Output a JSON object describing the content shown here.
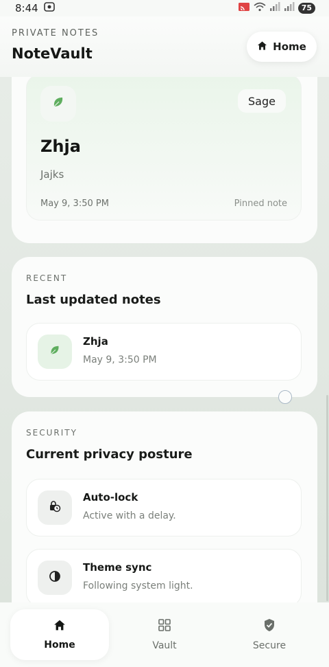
{
  "status_bar": {
    "time": "8:44",
    "battery": "75"
  },
  "header": {
    "eyebrow": "PRIVATE NOTES",
    "title": "NoteVault",
    "home_label": "Home"
  },
  "pinned": {
    "tag": "Sage",
    "title": "Zhja",
    "body": "Jajks",
    "date": "May 9, 3:50 PM",
    "flag": "Pinned note",
    "icon": "leaf-icon"
  },
  "recent": {
    "eyebrow": "RECENT",
    "heading": "Last updated notes",
    "items": [
      {
        "title": "Zhja",
        "date": "May 9, 3:50 PM",
        "icon": "leaf-icon"
      }
    ]
  },
  "security": {
    "eyebrow": "SECURITY",
    "heading": "Current privacy posture",
    "items": [
      {
        "title": "Auto-lock",
        "subtitle": "Active with a delay.",
        "icon": "lock-timer-icon"
      },
      {
        "title": "Theme sync",
        "subtitle": "Following system light.",
        "icon": "contrast-icon"
      }
    ]
  },
  "nav": {
    "items": [
      {
        "label": "Home",
        "icon": "home-icon",
        "active": true
      },
      {
        "label": "Vault",
        "icon": "grid-icon",
        "active": false
      },
      {
        "label": "Secure",
        "icon": "shield-icon",
        "active": false
      }
    ]
  },
  "colors": {
    "accent_green": "#5fae5f",
    "background": "#e3e9e3",
    "card": "#fbfcfb"
  }
}
